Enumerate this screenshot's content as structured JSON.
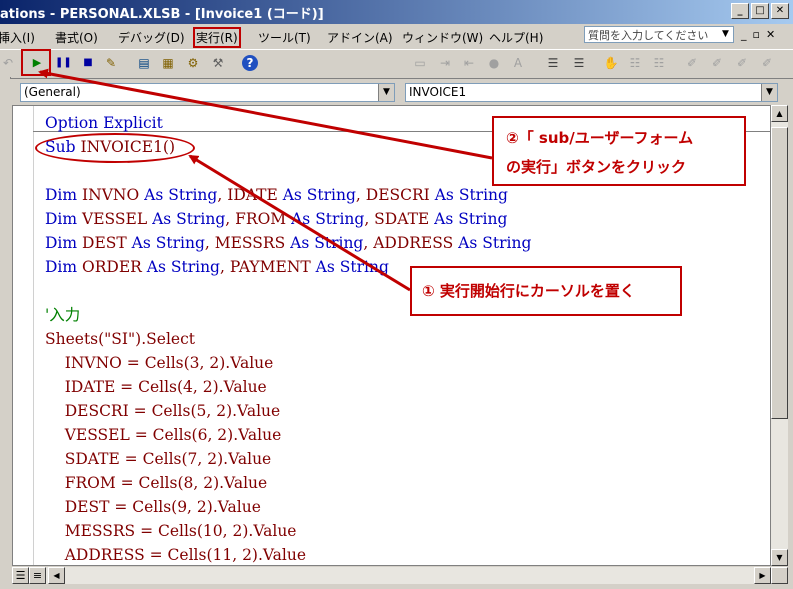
{
  "window": {
    "title": "ations - PERSONAL.XLSB - [Invoice1 (コード)]",
    "min_glyph": "_",
    "max_glyph": "□",
    "close_glyph": "✕"
  },
  "menu": {
    "items": [
      {
        "label": "挿入(I)"
      },
      {
        "label": "書式(O)"
      },
      {
        "label": "デバッグ(D)"
      },
      {
        "label": "実行(R)"
      },
      {
        "label": "ツール(T)"
      },
      {
        "label": "アドイン(A)"
      },
      {
        "label": "ウィンドウ(W)"
      },
      {
        "label": "ヘルプ(H)"
      }
    ],
    "help_box": "質問を入力してください"
  },
  "toolbar": {
    "icons": [
      "undo-icon",
      "run-icon",
      "break-icon",
      "reset-icon",
      "design-mode-icon",
      "project-explorer-icon",
      "properties-icon",
      "object-browser-icon",
      "toolbox-icon",
      "help-icon",
      "properties-window-icon",
      "indent-icon",
      "outdent-icon",
      "toggle-breakpoint-icon",
      "comment-icon",
      "uncomment-icon",
      "bookmark-icon",
      "next-bookmark-icon",
      "prev-bookmark-icon",
      "clear-bookmarks-icon"
    ]
  },
  "code_window": {
    "object_combo": "(General)",
    "procedure_combo": "INVOICE1",
    "lines": [
      {
        "text": "Option Explicit",
        "kind": "kw"
      },
      {
        "text": "Sub INVOICE1()",
        "kind": "kw"
      },
      {
        "text": "",
        "kind": "plain"
      },
      {
        "text": "Dim INVNO As String, IDATE As String, DESCRI As String",
        "kind": "kw"
      },
      {
        "text": "Dim VESSEL As String, FROM As String, SDATE As String",
        "kind": "kw"
      },
      {
        "text": "Dim DEST As String, MESSRS As String, ADDRESS As String",
        "kind": "kw"
      },
      {
        "text": "Dim ORDER As String, PAYMENT As String",
        "kind": "kw"
      },
      {
        "text": "",
        "kind": "plain"
      },
      {
        "text": "'入力",
        "kind": "cm"
      },
      {
        "text": "Sheets(\"SI\").Select",
        "kind": "plain"
      },
      {
        "text": "    INVNO = Cells(3, 2).Value",
        "kind": "plain"
      },
      {
        "text": "    IDATE = Cells(4, 2).Value",
        "kind": "plain"
      },
      {
        "text": "    DESCRI = Cells(5, 2).Value",
        "kind": "plain"
      },
      {
        "text": "    VESSEL = Cells(6, 2).Value",
        "kind": "plain"
      },
      {
        "text": "    SDATE = Cells(7, 2).Value",
        "kind": "plain"
      },
      {
        "text": "    FROM = Cells(8, 2).Value",
        "kind": "plain"
      },
      {
        "text": "    DEST = Cells(9, 2).Value",
        "kind": "plain"
      },
      {
        "text": "    MESSRS = Cells(10, 2).Value",
        "kind": "plain"
      },
      {
        "text": "    ADDRESS = Cells(11, 2).Value",
        "kind": "plain"
      }
    ]
  },
  "callouts": {
    "step2_line1": "②「 sub/ユーザーフォーム",
    "step2_line2": "の実行」ボタンをクリック",
    "step1": "① 実行開始行にカーソルを置く"
  },
  "colors": {
    "keyword": "#0000c0",
    "identifier": "#800000",
    "comment": "#008000",
    "annotation": "#c00000"
  }
}
